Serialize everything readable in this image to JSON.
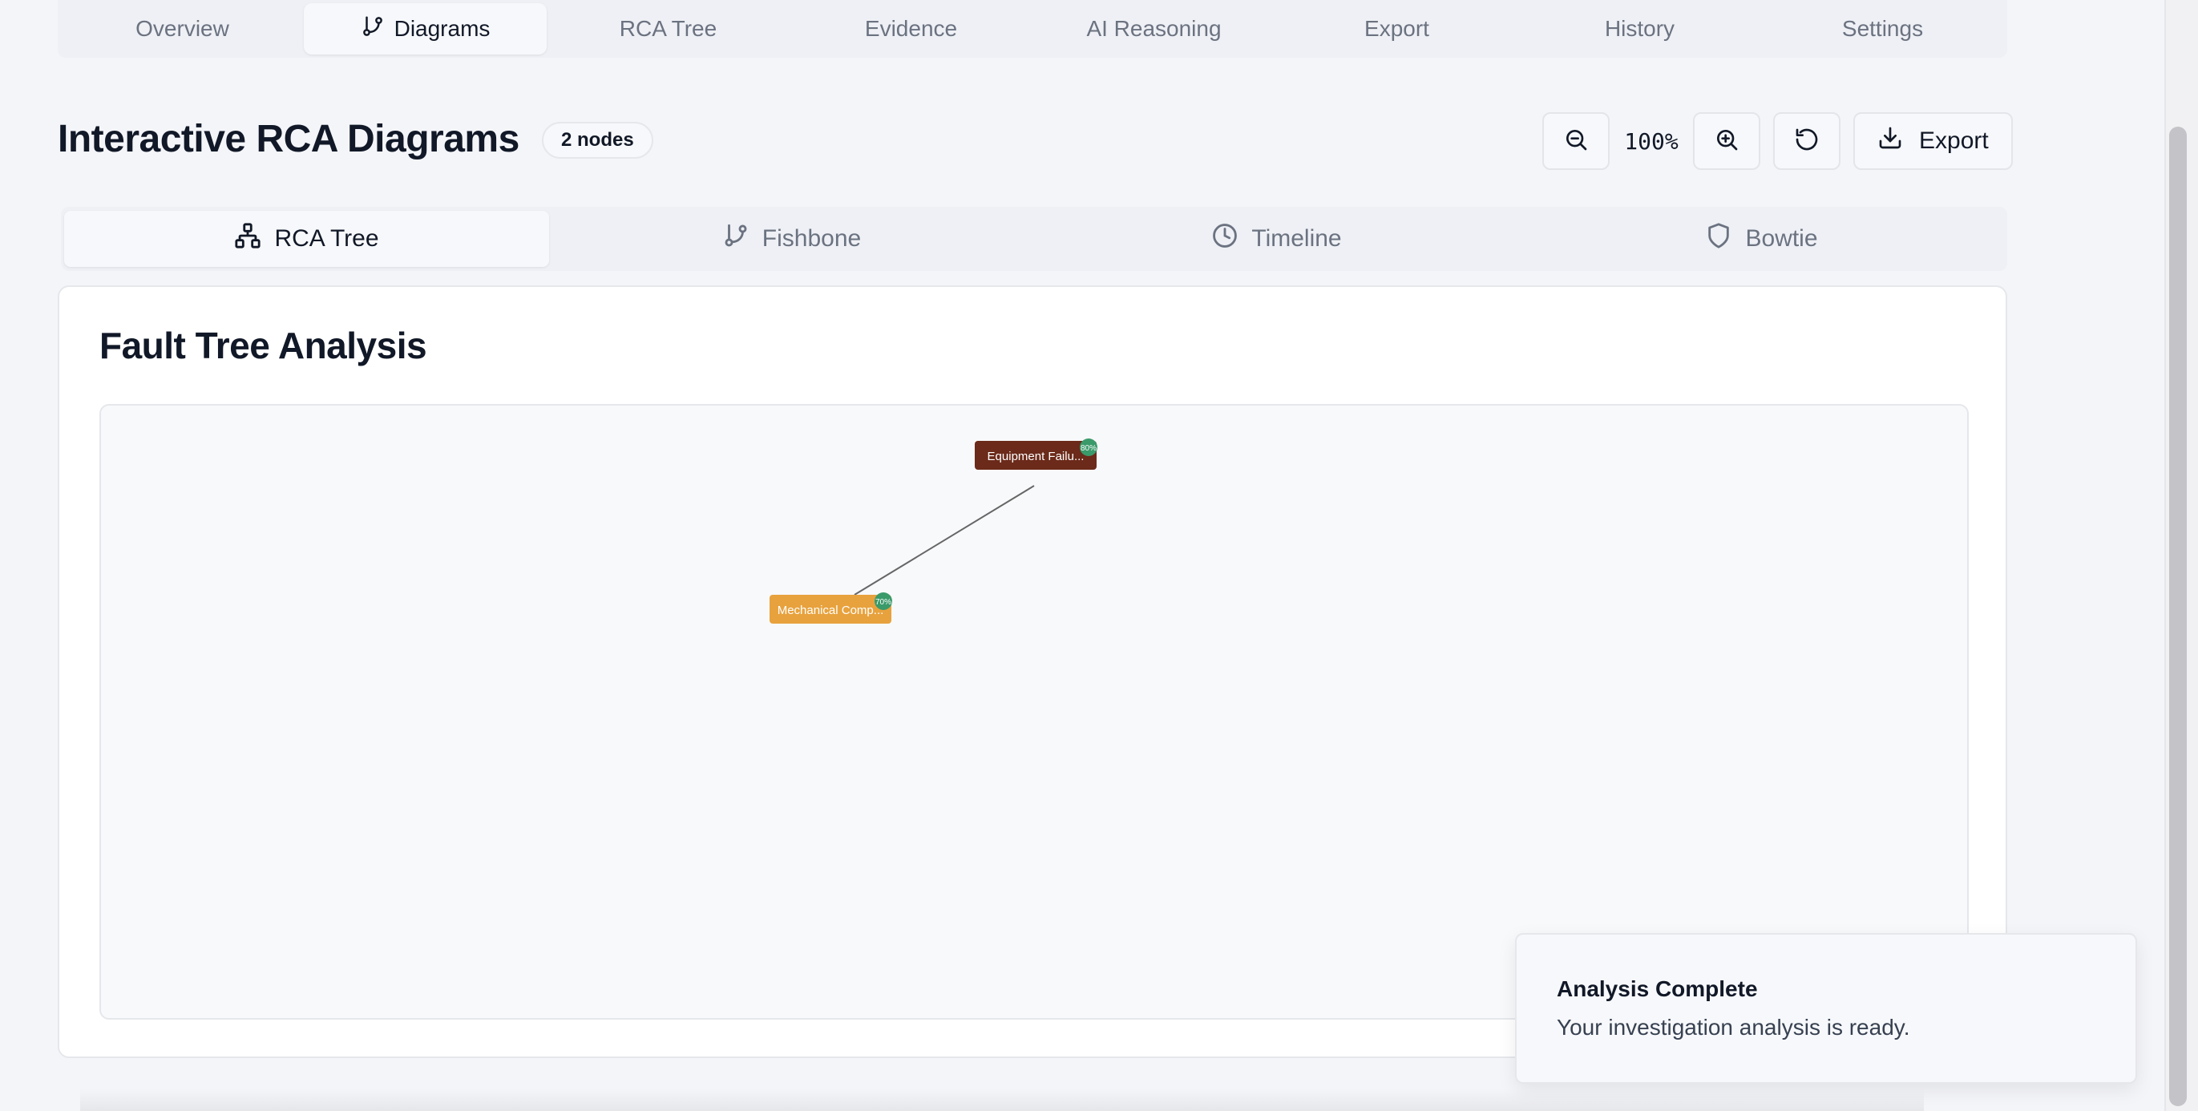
{
  "top_tabs": [
    {
      "label": "Overview",
      "icon": "",
      "active": false
    },
    {
      "label": "Diagrams",
      "icon": "git-branch-icon",
      "active": true
    },
    {
      "label": "RCA Tree",
      "icon": "",
      "active": false
    },
    {
      "label": "Evidence",
      "icon": "",
      "active": false
    },
    {
      "label": "AI Reasoning",
      "icon": "",
      "active": false
    },
    {
      "label": "Export",
      "icon": "",
      "active": false
    },
    {
      "label": "History",
      "icon": "",
      "active": false
    },
    {
      "label": "Settings",
      "icon": "",
      "active": false
    }
  ],
  "header": {
    "title": "Interactive RCA Diagrams",
    "node_count": "2 nodes"
  },
  "toolbar": {
    "zoom_out_icon": "zoom-out-icon",
    "zoom_level": "100%",
    "zoom_in_icon": "zoom-in-icon",
    "reset_icon": "rotate-ccw-icon",
    "export_label": "Export",
    "export_icon": "download-icon"
  },
  "diagram_tabs": [
    {
      "label": "RCA Tree",
      "icon": "network-icon",
      "active": true
    },
    {
      "label": "Fishbone",
      "icon": "git-branch-icon",
      "active": false
    },
    {
      "label": "Timeline",
      "icon": "clock-icon",
      "active": false
    },
    {
      "label": "Bowtie",
      "icon": "shield-icon",
      "active": false
    }
  ],
  "card": {
    "title": "Fault Tree Analysis"
  },
  "tree": {
    "nodes": [
      {
        "id": "root",
        "label": "Equipment Failu...",
        "confidence": "80%",
        "color": "#6b2a1a",
        "badge_color": "#3a9a6a"
      },
      {
        "id": "child1",
        "label": "Mechanical Comp...",
        "confidence": "70%",
        "color": "#e8a23d",
        "badge_color": "#3a9a6a"
      }
    ],
    "edges": [
      {
        "from": "root",
        "to": "child1",
        "color": "#666666"
      }
    ]
  },
  "toast": {
    "title": "Analysis Complete",
    "message": "Your investigation analysis is ready."
  }
}
